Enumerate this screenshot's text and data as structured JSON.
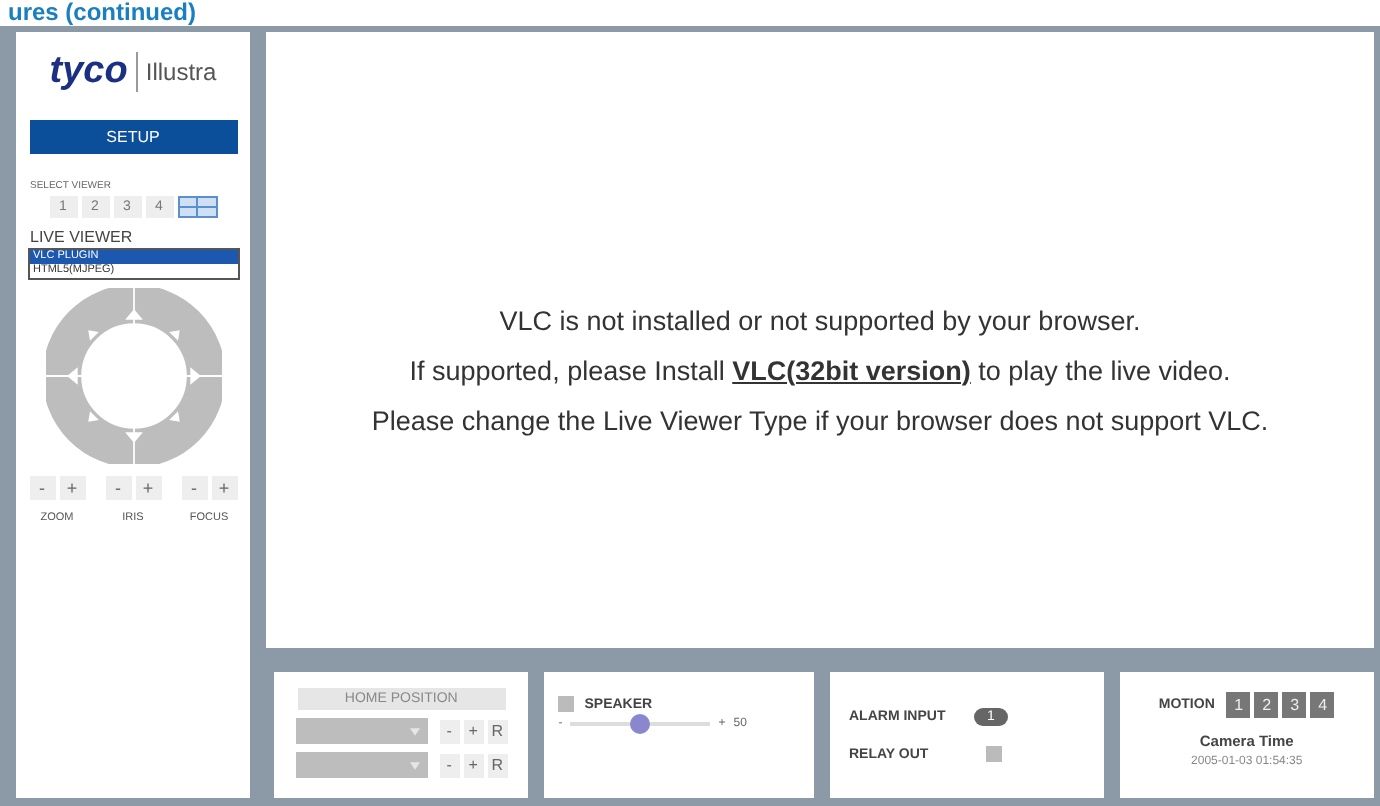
{
  "heading": "ures (continued)",
  "sidebar": {
    "brand": "tyco",
    "sub_brand": "Illustra",
    "setup_button": "SETUP",
    "select_viewer": {
      "label": "SELECT VIEWER",
      "options": [
        {
          "kind": "single",
          "label": "1",
          "selected": false
        },
        {
          "kind": "single",
          "label": "2",
          "selected": false
        },
        {
          "kind": "single",
          "label": "3",
          "selected": false
        },
        {
          "kind": "single",
          "label": "4",
          "selected": false
        },
        {
          "kind": "quad",
          "selected": true
        }
      ]
    },
    "live_viewer": {
      "label": "LIVE VIEWER",
      "options": [
        {
          "label": "VLC PLUGIN",
          "selected": true
        },
        {
          "label": "HTML5(MJPEG)",
          "selected": false
        }
      ]
    },
    "lens_controls": [
      {
        "label": "ZOOM",
        "minus": "-",
        "plus": "+"
      },
      {
        "label": "IRIS",
        "minus": "-",
        "plus": "+"
      },
      {
        "label": "FOCUS",
        "minus": "-",
        "plus": "+"
      }
    ]
  },
  "video_message": {
    "line1": "VLC is not installed or not supported by your browser.",
    "line2_before": "If supported, please Install ",
    "link": "VLC(32bit version)",
    "line2_after": " to play the live video.",
    "line3": "Please change the Live Viewer Type if your browser does not support VLC."
  },
  "home_position": {
    "button": "HOME POSITION",
    "disabled": true,
    "rows": [
      {
        "minus": "-",
        "plus": "+",
        "reset": "R"
      },
      {
        "minus": "-",
        "plus": "+",
        "reset": "R"
      }
    ]
  },
  "speaker": {
    "label": "SPEAKER",
    "checked": false,
    "min": "-",
    "max": "+",
    "level": 0.5,
    "reading": "50"
  },
  "alarm": {
    "alarm_input_label": "ALARM INPUT",
    "alarm_input_badge": "1",
    "relay_out_label": "RELAY OUT",
    "relay_out_checked": false
  },
  "motion": {
    "label": "MOTION",
    "zones": [
      "1",
      "2",
      "3",
      "4"
    ],
    "camera_time_label": "Camera Time",
    "camera_time": "2005-01-03 01:54:35"
  }
}
